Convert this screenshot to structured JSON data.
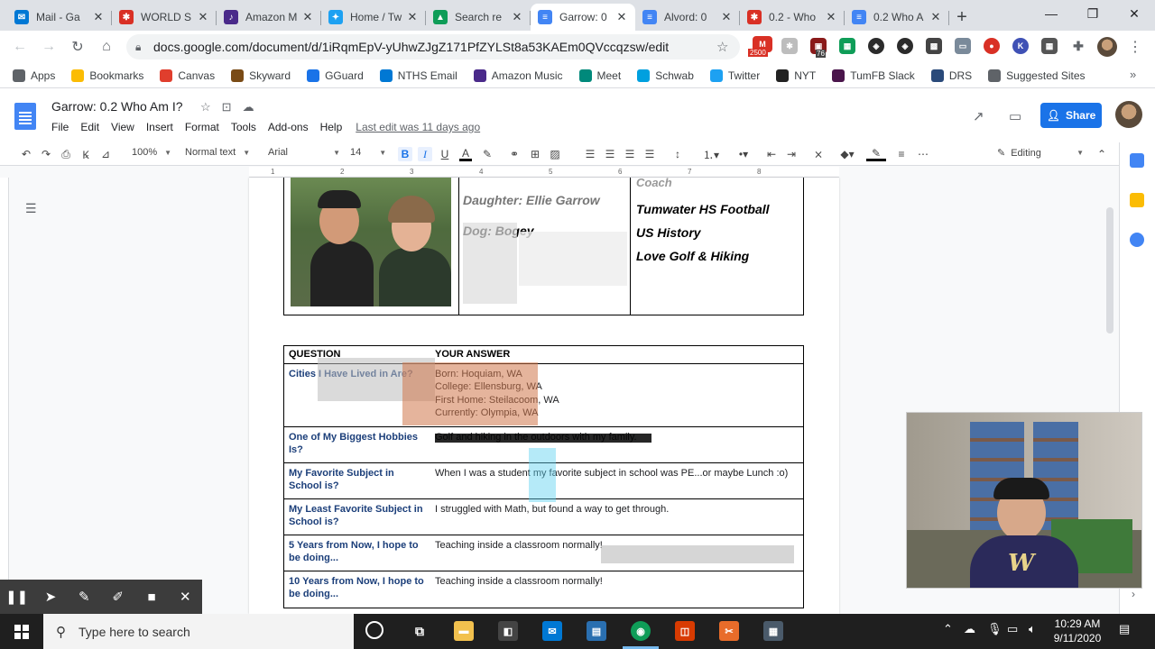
{
  "browser": {
    "tabs": [
      {
        "title": "Mail - Ga",
        "color": "#0078d4",
        "glyph": "✉"
      },
      {
        "title": "WORLD S",
        "color": "#d93025",
        "glyph": "✱"
      },
      {
        "title": "Amazon M",
        "color": "#4a2a8a",
        "glyph": "♪"
      },
      {
        "title": "Home / Tw",
        "color": "#1da1f2",
        "glyph": "✦"
      },
      {
        "title": "Search re",
        "color": "#0f9d58",
        "glyph": "▲"
      },
      {
        "title": "Garrow: 0",
        "color": "#4285f4",
        "glyph": "≡",
        "active": true
      },
      {
        "title": "Alvord: 0",
        "color": "#4285f4",
        "glyph": "≡"
      },
      {
        "title": "0.2 - Who",
        "color": "#d93025",
        "glyph": "✱"
      },
      {
        "title": "0.2 Who A",
        "color": "#4285f4",
        "glyph": "≡"
      }
    ],
    "new_tab": "+",
    "url": "docs.google.com/document/d/1iRqmEpV-yUhwZJgZ171PfZYLSt8a53KAEm0QVccqzsw/edit",
    "gmail_badge": "2500",
    "ext_badge": "76",
    "bookmarks": [
      {
        "label": "Apps",
        "color": "#5f6368"
      },
      {
        "label": "Bookmarks",
        "color": "#fbbc04"
      },
      {
        "label": "Canvas",
        "color": "#e03e2d"
      },
      {
        "label": "Skyward",
        "color": "#7a4b16"
      },
      {
        "label": "GGuard",
        "color": "#1a73e8"
      },
      {
        "label": "NTHS Email",
        "color": "#0078d4"
      },
      {
        "label": "Amazon Music",
        "color": "#4a2a8a"
      },
      {
        "label": "Meet",
        "color": "#00897b"
      },
      {
        "label": "Schwab",
        "color": "#00a0df"
      },
      {
        "label": "Twitter",
        "color": "#1da1f2"
      },
      {
        "label": "NYT",
        "color": "#222222"
      },
      {
        "label": "TumFB Slack",
        "color": "#4a154b"
      },
      {
        "label": "DRS",
        "color": "#2a4a7a"
      },
      {
        "label": "Suggested Sites",
        "color": "#5f6368"
      }
    ]
  },
  "docs": {
    "title": "Garrow: 0.2 Who Am I?",
    "menus": [
      "File",
      "Edit",
      "View",
      "Insert",
      "Format",
      "Tools",
      "Add-ons",
      "Help"
    ],
    "last_edit": "Last edit was 11 days ago",
    "share_label": "Share",
    "toolbar": {
      "zoom": "100%",
      "style": "Normal text",
      "font": "Arial",
      "size": "14",
      "mode": "Editing"
    },
    "ruler_numbers": [
      "1",
      "2",
      "3",
      "4",
      "5",
      "6",
      "7",
      "8"
    ],
    "profile_mid": [
      "Daughter: Ellie Garrow",
      "Dog: Bogey"
    ],
    "profile_right_top": "Coach",
    "profile_right": [
      "Tumwater HS Football",
      "US History",
      "Love Golf & Hiking"
    ],
    "table_header": {
      "question": "QUESTION",
      "answer": "YOUR ANSWER"
    },
    "rows": [
      {
        "q": "Cities I Have Lived in Are?",
        "a": [
          "Born: Hoquiam, WA",
          "College: Ellensburg, WA",
          "First Home: Steilacoom, WA",
          "Currently: Olympia, WA"
        ]
      },
      {
        "q": "One of My Biggest Hobbies Is?",
        "a": [
          "Golf and hiking in the outdoors with my family."
        ]
      },
      {
        "q": "My Favorite Subject in School is?",
        "a": [
          "When I was a student my favorite subject in school was PE...or maybe Lunch :o)"
        ]
      },
      {
        "q": "My Least Favorite Subject in School is?",
        "a": [
          "I struggled with Math, but found a way to get through."
        ]
      },
      {
        "q": "5 Years from Now, I hope to be doing...",
        "a": [
          "Teaching inside a classroom normally!"
        ]
      },
      {
        "q": "10 Years from Now, I hope to be doing...",
        "a": [
          "Teaching inside a classroom normally!"
        ]
      }
    ]
  },
  "taskbar": {
    "search_placeholder": "Type here to search",
    "time": "10:29 AM",
    "date": "9/11/2020"
  }
}
